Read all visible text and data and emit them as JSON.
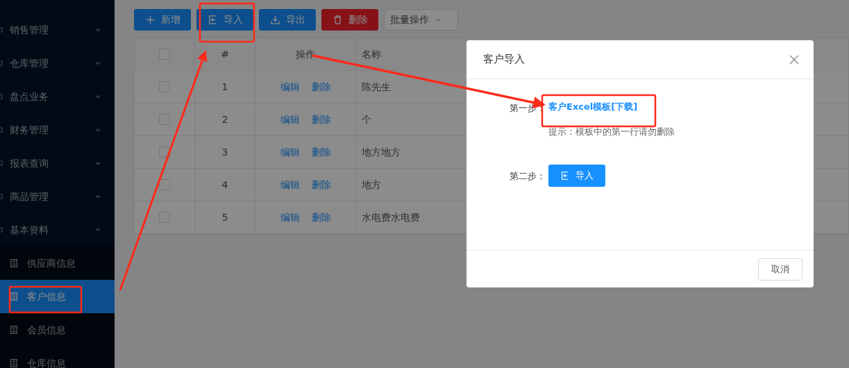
{
  "sidebar": {
    "items": [
      {
        "label": "销售管理",
        "expanded": false
      },
      {
        "label": "仓库管理",
        "expanded": false
      },
      {
        "label": "盘点业务",
        "expanded": false
      },
      {
        "label": "财务管理",
        "expanded": false
      },
      {
        "label": "报表查询",
        "expanded": false
      },
      {
        "label": "商品管理",
        "expanded": false
      },
      {
        "label": "基本资料",
        "expanded": true,
        "children": [
          {
            "label": "供应商信息",
            "selected": false
          },
          {
            "label": "客户信息",
            "selected": true
          },
          {
            "label": "会员信息",
            "selected": false
          },
          {
            "label": "仓库信息",
            "selected": false
          }
        ]
      }
    ]
  },
  "toolbar": {
    "buttons": [
      {
        "label": "新增",
        "kind": "add"
      },
      {
        "label": "导入",
        "kind": "import"
      },
      {
        "label": "导出",
        "kind": "export"
      },
      {
        "label": "删除",
        "kind": "delete"
      },
      {
        "label": "批量操作",
        "kind": "dropdown"
      }
    ]
  },
  "table": {
    "select_all_checked": false,
    "columns": [
      "#",
      "操作",
      "名称"
    ],
    "rows": [
      {
        "checked": false,
        "index": "1",
        "actions": [
          "编辑",
          "删除"
        ],
        "name": "陈先生"
      },
      {
        "checked": false,
        "index": "2",
        "actions": [
          "编辑",
          "删除"
        ],
        "name": "个"
      },
      {
        "checked": false,
        "index": "3",
        "actions": [
          "编辑",
          "删除"
        ],
        "name": "地方地方"
      },
      {
        "checked": false,
        "index": "4",
        "actions": [
          "编辑",
          "删除"
        ],
        "name": "地方"
      },
      {
        "checked": false,
        "index": "5",
        "actions": [
          "编辑",
          "删除"
        ],
        "name": "水电费水电费"
      }
    ]
  },
  "modal": {
    "title": "客户导入",
    "steps": [
      {
        "kind": "link",
        "label": "第一步：",
        "link": "客户Excel模板[下载]",
        "hint": "提示：模板中的第一行请勿删除"
      },
      {
        "kind": "button",
        "label": "第二步：",
        "button": "导入"
      }
    ],
    "cancel": "取消"
  }
}
